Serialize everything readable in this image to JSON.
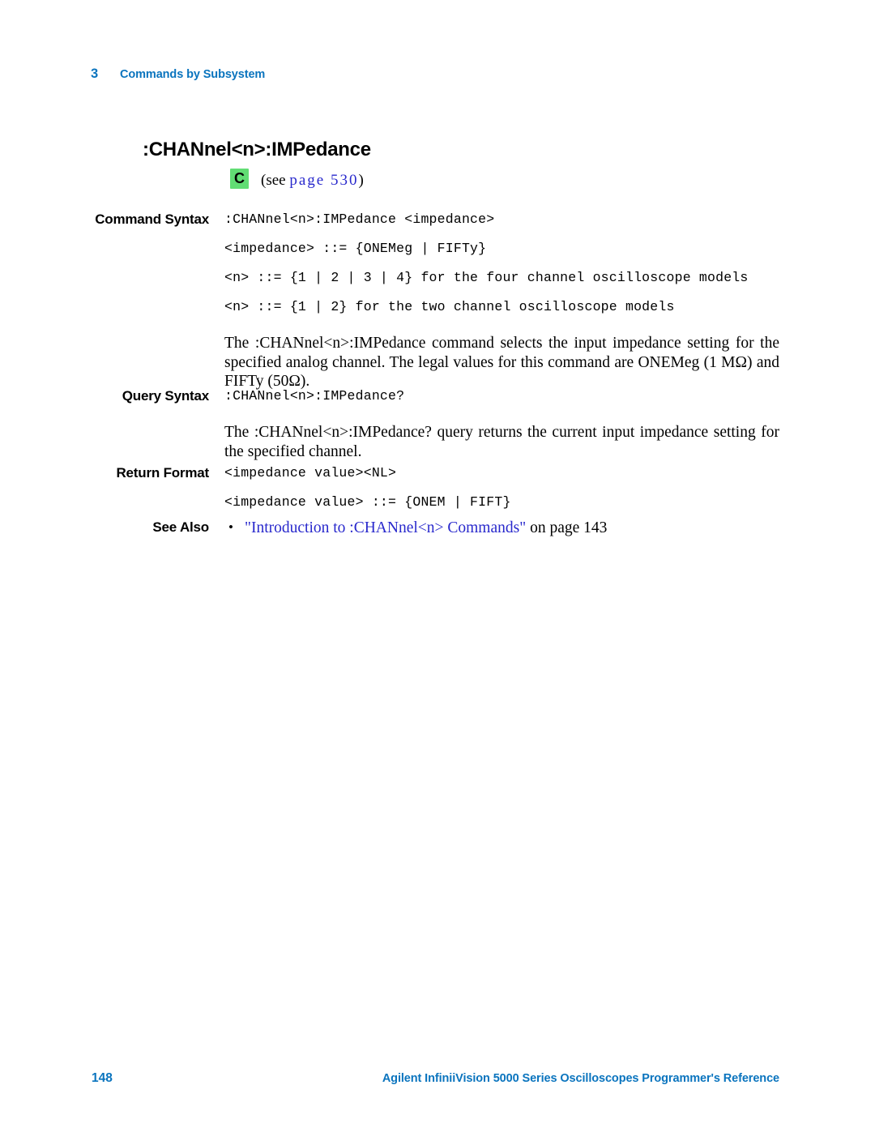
{
  "header": {
    "chapter_number": "3",
    "chapter_title": "Commands by Subsystem"
  },
  "command": {
    "title": ":CHANnel<n>:IMPedance",
    "capability_badge": "C",
    "see_prefix": "(see ",
    "see_link": "page  530",
    "see_suffix": ")"
  },
  "sections": {
    "command_syntax": {
      "label": "Command Syntax",
      "lines": [
        ":CHANnel<n>:IMPedance <impedance>",
        "<impedance> ::= {ONEMeg | FIFTy}",
        "<n> ::= {1 | 2 | 3 | 4} for the four channel oscilloscope models",
        "<n> ::= {1 | 2} for the two channel oscilloscope models"
      ],
      "description": "The :CHANnel<n>:IMPedance command selects the input impedance setting for the specified analog channel. The legal values for this command are ONEMeg (1 MΩ) and FIFTy (50Ω)."
    },
    "query_syntax": {
      "label": "Query Syntax",
      "lines": [
        ":CHANnel<n>:IMPedance?"
      ],
      "description": "The :CHANnel<n>:IMPedance? query returns the current input impedance setting for the specified channel."
    },
    "return_format": {
      "label": "Return Format",
      "lines": [
        "<impedance value><NL>",
        "<impedance value> ::= {ONEM | FIFT}"
      ]
    },
    "see_also": {
      "label": "See Also",
      "bullet": "•",
      "link_text": "\"Introduction to :CHANnel<n> Commands\"",
      "after_text": " on page  143"
    }
  },
  "footer": {
    "page_number": "148",
    "book_title": "Agilent InfiniiVision 5000 Series Oscilloscopes Programmer's Reference"
  },
  "colors": {
    "accent_blue": "#0A74BE",
    "link_blue": "#2828CC",
    "badge_green": "#61DD74"
  }
}
